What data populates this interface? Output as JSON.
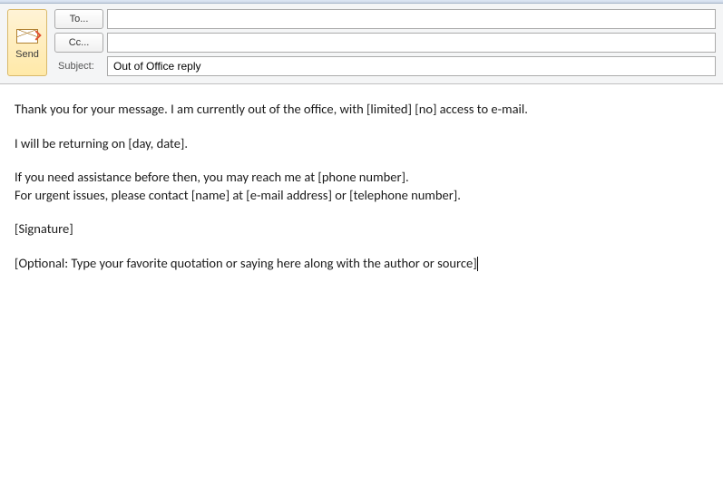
{
  "header": {
    "send_label": "Send",
    "to_label": "To...",
    "cc_label": "Cc...",
    "subject_label": "Subject:",
    "to_value": "",
    "cc_value": "",
    "subject_value": "Out of Office reply"
  },
  "body": {
    "p1": "Thank you for your message. I am currently out of the office, with [limited] [no] access to e-mail.",
    "p2": "I will be returning on [day, date].",
    "p3a": "If you need assistance before then, you may reach me at [phone number].",
    "p3b": "For urgent issues, please contact [name] at [e-mail address] or [telephone number].",
    "p4": "[Signature]",
    "p5": "[Optional: Type your favorite quotation or saying here along with the author or source]"
  }
}
